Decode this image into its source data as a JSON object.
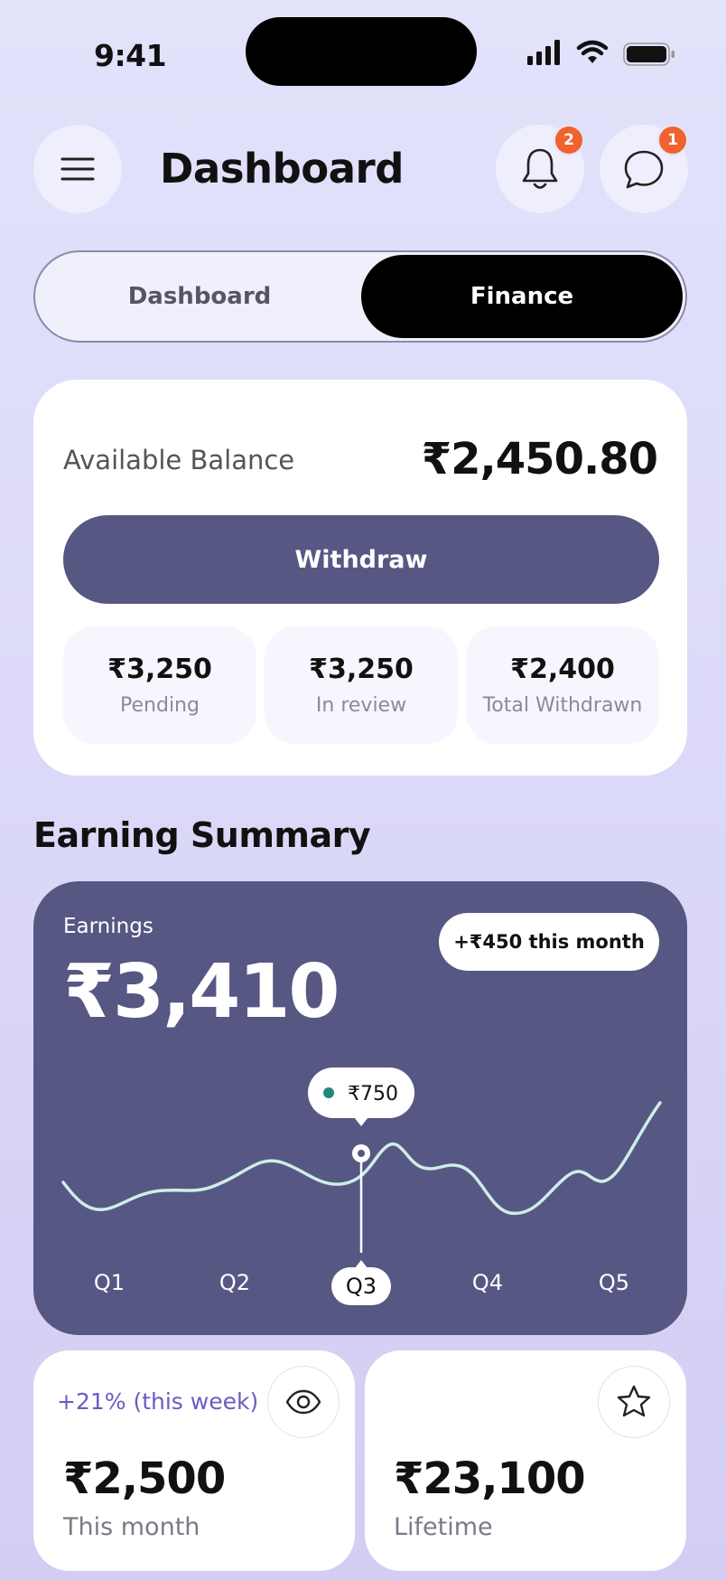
{
  "status_bar": {
    "time": "9:41"
  },
  "header": {
    "title": "Dashboard",
    "notifications_badge": "2",
    "messages_badge": "1",
    "menu_icon": "hamburger-menu-icon",
    "bell_icon": "bell-icon",
    "chat_icon": "chat-bubble-icon"
  },
  "tabs": [
    {
      "label": "Dashboard",
      "active": false
    },
    {
      "label": "Finance",
      "active": true
    }
  ],
  "balance": {
    "label": "Available Balance",
    "value": "₹2,450.80",
    "withdraw_label": "Withdraw",
    "stats": [
      {
        "value": "₹3,250",
        "label": "Pending"
      },
      {
        "value": "₹3,250",
        "label": "In review"
      },
      {
        "value": "₹2,400",
        "label": "Total Withdrawn"
      }
    ]
  },
  "earning_summary": {
    "title": "Earning Summary",
    "label": "Earnings",
    "value": "₹3,410",
    "month_change": "+₹450 this month",
    "tooltip": "₹750",
    "active_quarter": "Q3"
  },
  "chart_data": {
    "type": "line",
    "categories": [
      "Q1",
      "Q2",
      "Q3",
      "Q4",
      "Q5"
    ],
    "highlight": {
      "category": "Q3",
      "label": "₹750"
    },
    "colors": {
      "line": "#cdeee6",
      "background": "#575784",
      "tooltip_dot": "#1f8a7a"
    }
  },
  "bottom_cards": [
    {
      "change": "+21% (this week)",
      "value": "₹2,500",
      "label": "This month",
      "icon": "eye-icon"
    },
    {
      "change": "",
      "value": "₹23,100",
      "label": "Lifetime",
      "icon": "star-icon"
    }
  ],
  "colors": {
    "accent": "#575784",
    "badge": "#f0622f",
    "positive_text": "#6a5cc4"
  }
}
